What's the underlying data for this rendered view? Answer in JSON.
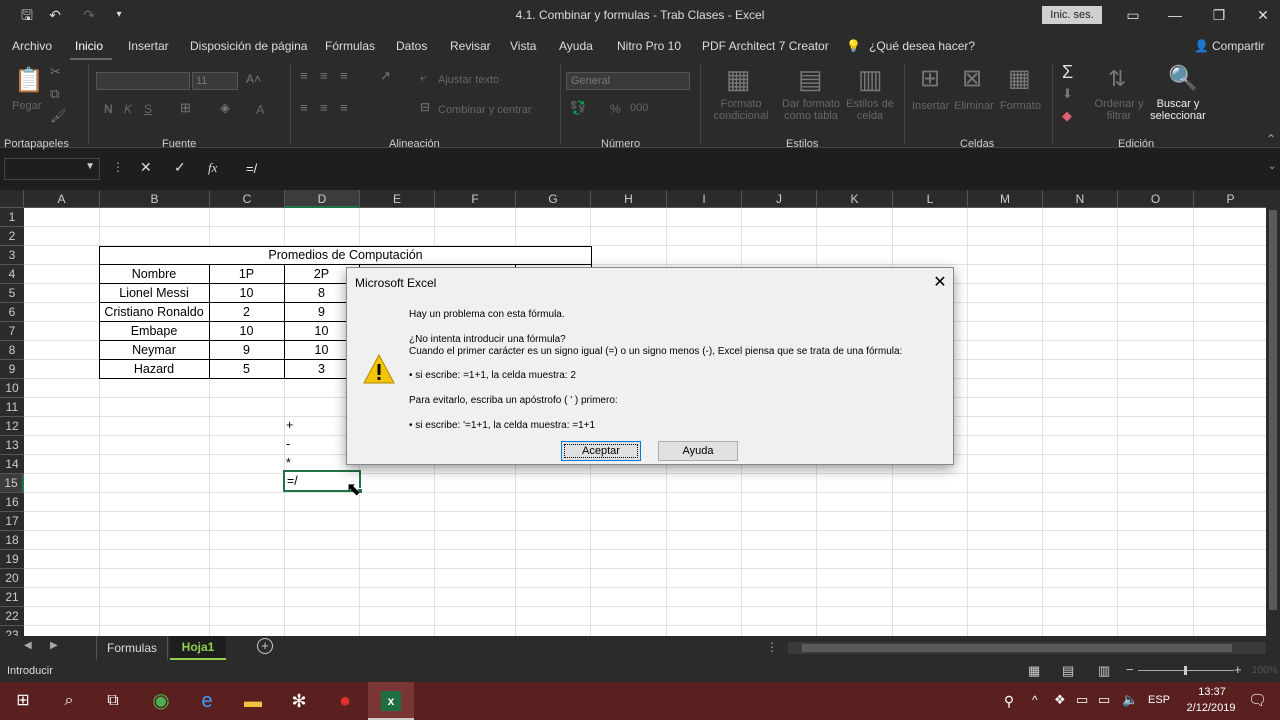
{
  "window": {
    "title": "4.1. Combinar y formulas - Trab Clases  -  Excel",
    "signin": "Inic. ses."
  },
  "menu": {
    "items": [
      "Archivo",
      "Inicio",
      "Insertar",
      "Disposición de página",
      "Fórmulas",
      "Datos",
      "Revisar",
      "Vista",
      "Ayuda",
      "Nitro Pro 10",
      "PDF Architect 7 Creator"
    ],
    "tell_me": "¿Qué desea hacer?",
    "share": "Compartir"
  },
  "ribbon": {
    "groups": [
      "Portapapeles",
      "Fuente",
      "Alineación",
      "Número",
      "Estilos",
      "Celdas",
      "Edición"
    ],
    "paste": "Pegar",
    "font_size": "11",
    "wrap": "Ajustar texto",
    "merge": "Combinar y centrar",
    "number_format": "General",
    "cond_format": "Formato condicional",
    "table_format": "Dar formato como tabla",
    "cell_styles": "Estilos de celda",
    "insert": "Insertar",
    "delete": "Eliminar",
    "format": "Formato",
    "sort": "Ordenar y filtrar",
    "find": "Buscar y seleccionar"
  },
  "formula_bar": {
    "name_box": "",
    "value": "=/"
  },
  "columns": [
    "A",
    "B",
    "C",
    "D",
    "E",
    "F",
    "G",
    "H",
    "I",
    "J",
    "K",
    "L",
    "M",
    "N",
    "O",
    "P"
  ],
  "rows": [
    "1",
    "2",
    "3",
    "4",
    "5",
    "6",
    "7",
    "8",
    "9",
    "10",
    "11",
    "12",
    "13",
    "14",
    "15",
    "16",
    "17",
    "18",
    "19",
    "20",
    "21",
    "22",
    "23"
  ],
  "table": {
    "title": "Promedios de Computación",
    "headers": [
      "Nombre",
      "1P",
      "2P"
    ],
    "rows": [
      [
        "Lionel Messi",
        "10",
        "8"
      ],
      [
        "Cristiano Ronaldo",
        "2",
        "9"
      ],
      [
        "Embape",
        "10",
        "10"
      ],
      [
        "Neymar",
        "9",
        "10"
      ],
      [
        "Hazard",
        "5",
        "3"
      ]
    ]
  },
  "ops": {
    "r12": "+",
    "r13": "-",
    "r14": "*",
    "r15": "=/"
  },
  "dialog": {
    "title": "Microsoft Excel",
    "line1": "Hay un problema con esta fórmula.",
    "line2": "¿No intenta introducir una fórmula?",
    "line3": "Cuando el primer carácter es un signo igual (=) o un signo menos (-), Excel piensa que se trata de una fórmula:",
    "line4": "• si escribe:   =1+1, la celda muestra:  2",
    "line5": "Para evitarlo, escriba un apóstrofo ( ' ) primero:",
    "line6": "• si escribe:   '=1+1, la celda muestra:   =1+1",
    "ok": "Aceptar",
    "help": "Ayuda"
  },
  "sheets": [
    "Formulas",
    "Hoja1"
  ],
  "status": {
    "mode": "Introducir",
    "zoom": "100%"
  },
  "taskbar": {
    "lang": "ESP",
    "time": "13:37",
    "date": "2/12/2019"
  },
  "colors": {
    "accent": "#217346",
    "active_tab": "#92d050"
  }
}
